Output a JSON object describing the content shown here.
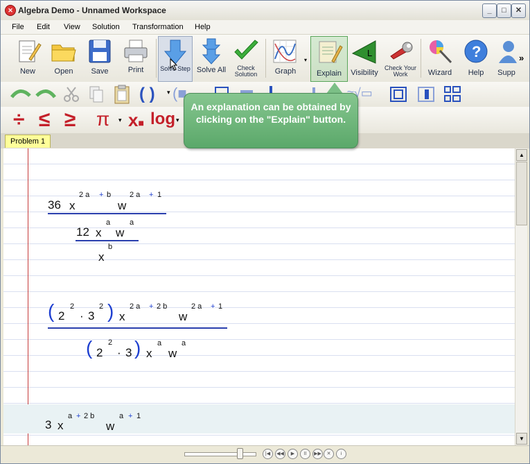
{
  "window": {
    "title": "Algebra Demo - Unnamed Workspace"
  },
  "menu": [
    "File",
    "Edit",
    "View",
    "Solution",
    "Transformation",
    "Help"
  ],
  "toolbar": {
    "new": "New",
    "open": "Open",
    "save": "Save",
    "print": "Print",
    "solve_step": "Solve Step",
    "solve_all": "Solve All",
    "check_solution": "Check Solution",
    "graph": "Graph",
    "explain": "Explain",
    "visibility": "Visibility",
    "check_your_work": "Check Your Work",
    "wizard": "Wizard",
    "help": "Help",
    "support": "Supp",
    "overflow": "»"
  },
  "tooltip": "An explanation can be obtained by clicking on the \"Explain\" button.",
  "tab": {
    "label": "Problem 1"
  },
  "expressions": {
    "e1": {
      "num_coef": "36",
      "x": "x",
      "x_exp_a": "2 a",
      "plus": "+",
      "x_exp_b": "b",
      "w": "w",
      "w_exp_a": "2 a",
      "w_exp_1": "1",
      "den_coef": "12",
      "den_x": "x",
      "den_x_exp": "a",
      "den_w": "w",
      "den_w_exp": "a",
      "sub_x": "x",
      "sub_x_exp": "b"
    },
    "e2": {
      "two": "2",
      "two_exp": "2",
      "dot": "·",
      "three": "3",
      "three_exp": "2",
      "x": "x",
      "x_exp_a": "2 a",
      "x_exp_b": "2 b",
      "w": "w",
      "w_exp_a": "2 a",
      "w_exp_1": "1",
      "den_two": "2",
      "den_two_exp": "2",
      "den_three": "3",
      "den_x": "x",
      "den_x_exp": "a",
      "den_w": "w",
      "den_w_exp": "a"
    },
    "e3": {
      "coef": "3",
      "x": "x",
      "x_exp_a": "a",
      "x_exp_b": "2 b",
      "w": "w",
      "w_exp_a": "a",
      "w_exp_1": "1"
    }
  }
}
